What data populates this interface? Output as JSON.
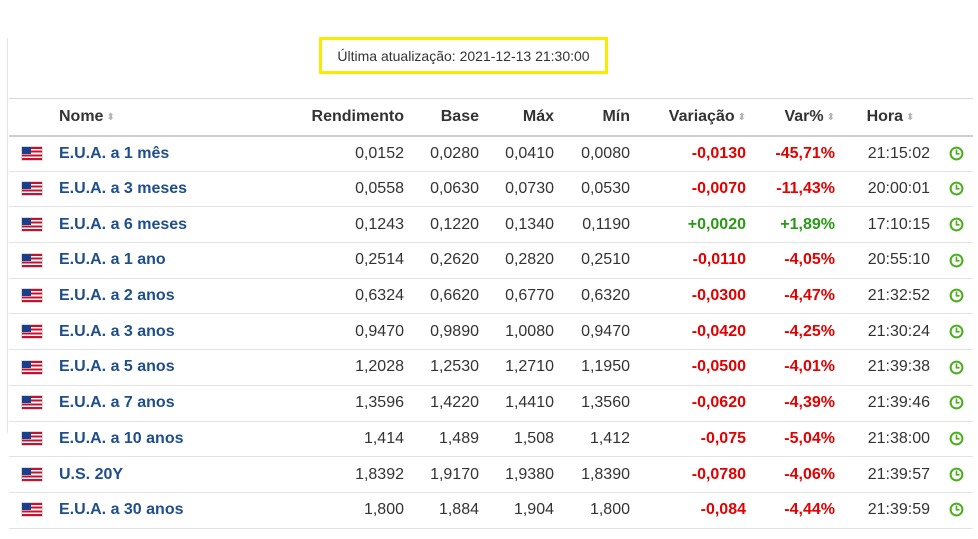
{
  "update": {
    "text": "Última atualização: 2021-12-13 21:30:00"
  },
  "table": {
    "headers": {
      "name": "Nome",
      "rendimento": "Rendimento",
      "base": "Base",
      "max": "Máx",
      "min": "Mín",
      "variacao": "Variação",
      "varpct": "Var%",
      "hora": "Hora"
    },
    "sort_glyph": "⬍",
    "rows": [
      {
        "name": "E.U.A. a 1 mês",
        "rend": "0,0152",
        "base": "0,0280",
        "max": "0,0410",
        "min": "0,0080",
        "var": "-0,0130",
        "varpct": "-45,71%",
        "hora": "21:15:02",
        "trend": "neg"
      },
      {
        "name": "E.U.A. a 3 meses",
        "rend": "0,0558",
        "base": "0,0630",
        "max": "0,0730",
        "min": "0,0530",
        "var": "-0,0070",
        "varpct": "-11,43%",
        "hora": "20:00:01",
        "trend": "neg"
      },
      {
        "name": "E.U.A. a 6 meses",
        "rend": "0,1243",
        "base": "0,1220",
        "max": "0,1340",
        "min": "0,1190",
        "var": "+0,0020",
        "varpct": "+1,89%",
        "hora": "17:10:15",
        "trend": "pos"
      },
      {
        "name": "E.U.A. a 1 ano",
        "rend": "0,2514",
        "base": "0,2620",
        "max": "0,2820",
        "min": "0,2510",
        "var": "-0,0110",
        "varpct": "-4,05%",
        "hora": "20:55:10",
        "trend": "neg"
      },
      {
        "name": "E.U.A. a 2 anos",
        "rend": "0,6324",
        "base": "0,6620",
        "max": "0,6770",
        "min": "0,6320",
        "var": "-0,0300",
        "varpct": "-4,47%",
        "hora": "21:32:52",
        "trend": "neg"
      },
      {
        "name": "E.U.A. a 3 anos",
        "rend": "0,9470",
        "base": "0,9890",
        "max": "1,0080",
        "min": "0,9470",
        "var": "-0,0420",
        "varpct": "-4,25%",
        "hora": "21:30:24",
        "trend": "neg"
      },
      {
        "name": "E.U.A. a 5 anos",
        "rend": "1,2028",
        "base": "1,2530",
        "max": "1,2710",
        "min": "1,1950",
        "var": "-0,0500",
        "varpct": "-4,01%",
        "hora": "21:39:38",
        "trend": "neg"
      },
      {
        "name": "E.U.A. a 7 anos",
        "rend": "1,3596",
        "base": "1,4220",
        "max": "1,4410",
        "min": "1,3560",
        "var": "-0,0620",
        "varpct": "-4,39%",
        "hora": "21:39:46",
        "trend": "neg"
      },
      {
        "name": "E.U.A. a 10 anos",
        "rend": "1,414",
        "base": "1,489",
        "max": "1,508",
        "min": "1,412",
        "var": "-0,075",
        "varpct": "-5,04%",
        "hora": "21:38:00",
        "trend": "neg"
      },
      {
        "name": "U.S. 20Y",
        "rend": "1,8392",
        "base": "1,9170",
        "max": "1,9380",
        "min": "1,8390",
        "var": "-0,0780",
        "varpct": "-4,06%",
        "hora": "21:39:57",
        "trend": "neg"
      },
      {
        "name": "E.U.A. a 30 anos",
        "rend": "1,800",
        "base": "1,884",
        "max": "1,904",
        "min": "1,800",
        "var": "-0,084",
        "varpct": "-4,44%",
        "hora": "21:39:59",
        "trend": "neg"
      }
    ]
  },
  "icons": {
    "flag": "us-flag-icon",
    "clock": "clock-icon",
    "sort": "sort-arrows-icon"
  },
  "colors": {
    "negative": "#e20000",
    "positive": "#2a9a14",
    "link": "#1f4e8a",
    "highlight_border": "#f5ec00",
    "clock": "#4caf1f"
  }
}
